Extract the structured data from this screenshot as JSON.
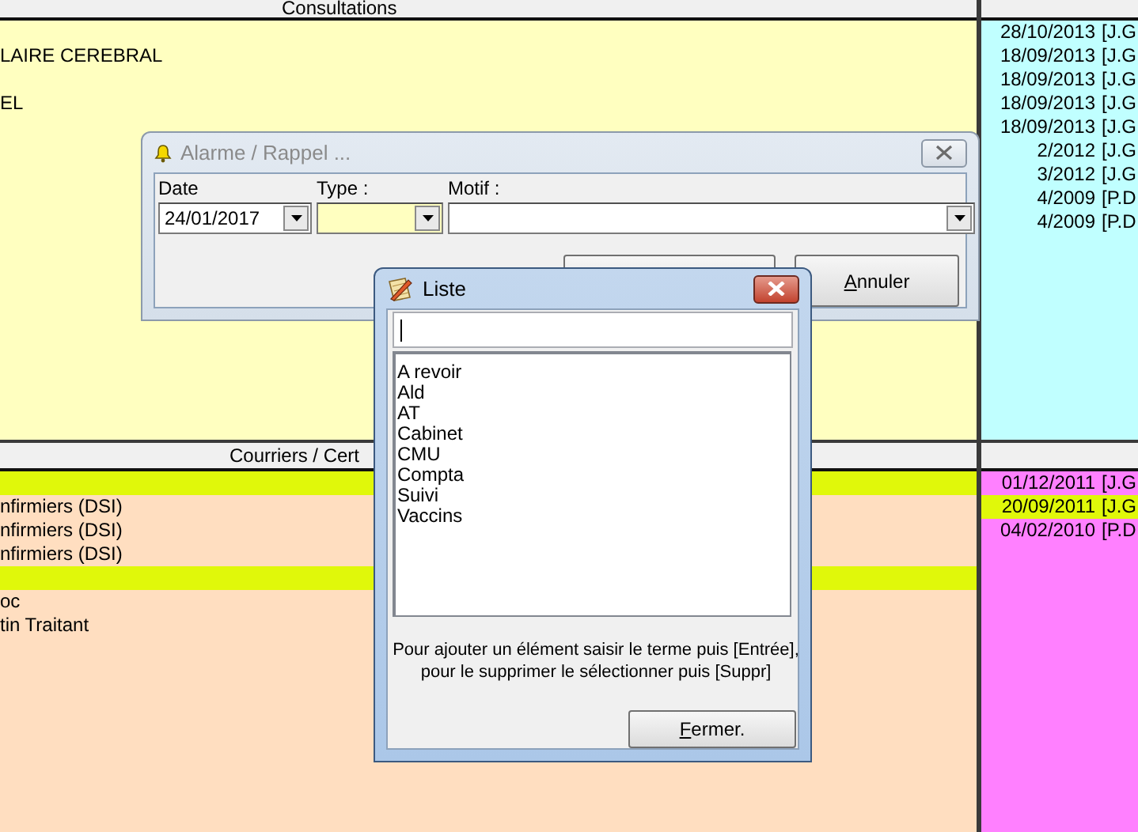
{
  "consultations": {
    "header": "Consultations",
    "rows": [
      {
        "highlighted": false
      },
      {
        "text": "LAIRE CEREBRAL",
        "highlighted": false
      },
      {
        "highlighted": false
      },
      {
        "text": "EL",
        "highlighted": false
      }
    ]
  },
  "consultations_dates": {
    "rows": [
      {
        "date": "28/10/2013",
        "author": "[J.G",
        "highlighted": false
      },
      {
        "date": "18/09/2013",
        "author": "[J.G",
        "highlighted": false
      },
      {
        "date": "18/09/2013",
        "author": "[J.G",
        "highlighted": false
      },
      {
        "date": "18/09/2013",
        "author": "[J.G",
        "highlighted": false
      },
      {
        "date": "18/09/2013",
        "author": "[J.G",
        "highlighted": false
      },
      {
        "date": "2/2012",
        "author": "[J.G",
        "highlighted": false
      },
      {
        "date": "3/2012",
        "author": "[J.G",
        "highlighted": false
      },
      {
        "date": "4/2009",
        "author": "[P.D",
        "highlighted": false
      },
      {
        "date": "4/2009",
        "author": "[P.D",
        "highlighted": false
      }
    ]
  },
  "courriers": {
    "header": "Courriers / Cert",
    "rows": [
      {
        "highlighted": true
      },
      {
        "text": "nfirmiers (DSI)",
        "highlighted": false
      },
      {
        "text": "nfirmiers (DSI)",
        "highlighted": false
      },
      {
        "text": "nfirmiers (DSI)",
        "highlighted": false
      },
      {
        "highlighted": true
      },
      {
        "text": "oc",
        "highlighted": false
      },
      {
        "text": "tin Traitant",
        "highlighted": false
      }
    ]
  },
  "courriers_dates": {
    "rows": [
      {
        "date": "01/12/2011",
        "author": "[J.G",
        "highlighted": false
      },
      {
        "date": "20/09/2011",
        "author": "[J.G",
        "highlighted": true
      },
      {
        "date": "04/02/2010",
        "author": "[P.D",
        "highlighted": false
      }
    ]
  },
  "alarm_dialog": {
    "title": "Alarme / Rappel ...",
    "active": false,
    "fields": [
      {
        "label": "Date",
        "value": "24/01/2017",
        "highlighted": false
      },
      {
        "label": "Type :",
        "highlighted": true
      },
      {
        "label": "Motif :",
        "highlighted": false
      }
    ],
    "buttons": [
      {
        "kind": "covered"
      },
      {
        "kind": "text",
        "label": "Annuler"
      }
    ]
  },
  "list_dialog": {
    "title": "Liste",
    "active": true,
    "items": [
      "A revoir",
      "Ald",
      "AT",
      "Cabinet",
      "CMU",
      "Compta",
      "Suivi",
      "Vaccins"
    ],
    "hint": "Pour ajouter un élément saisir le terme puis [Entrée],\npour le supprimer le sélectionner puis [Suppr]",
    "button": "Fermer."
  }
}
